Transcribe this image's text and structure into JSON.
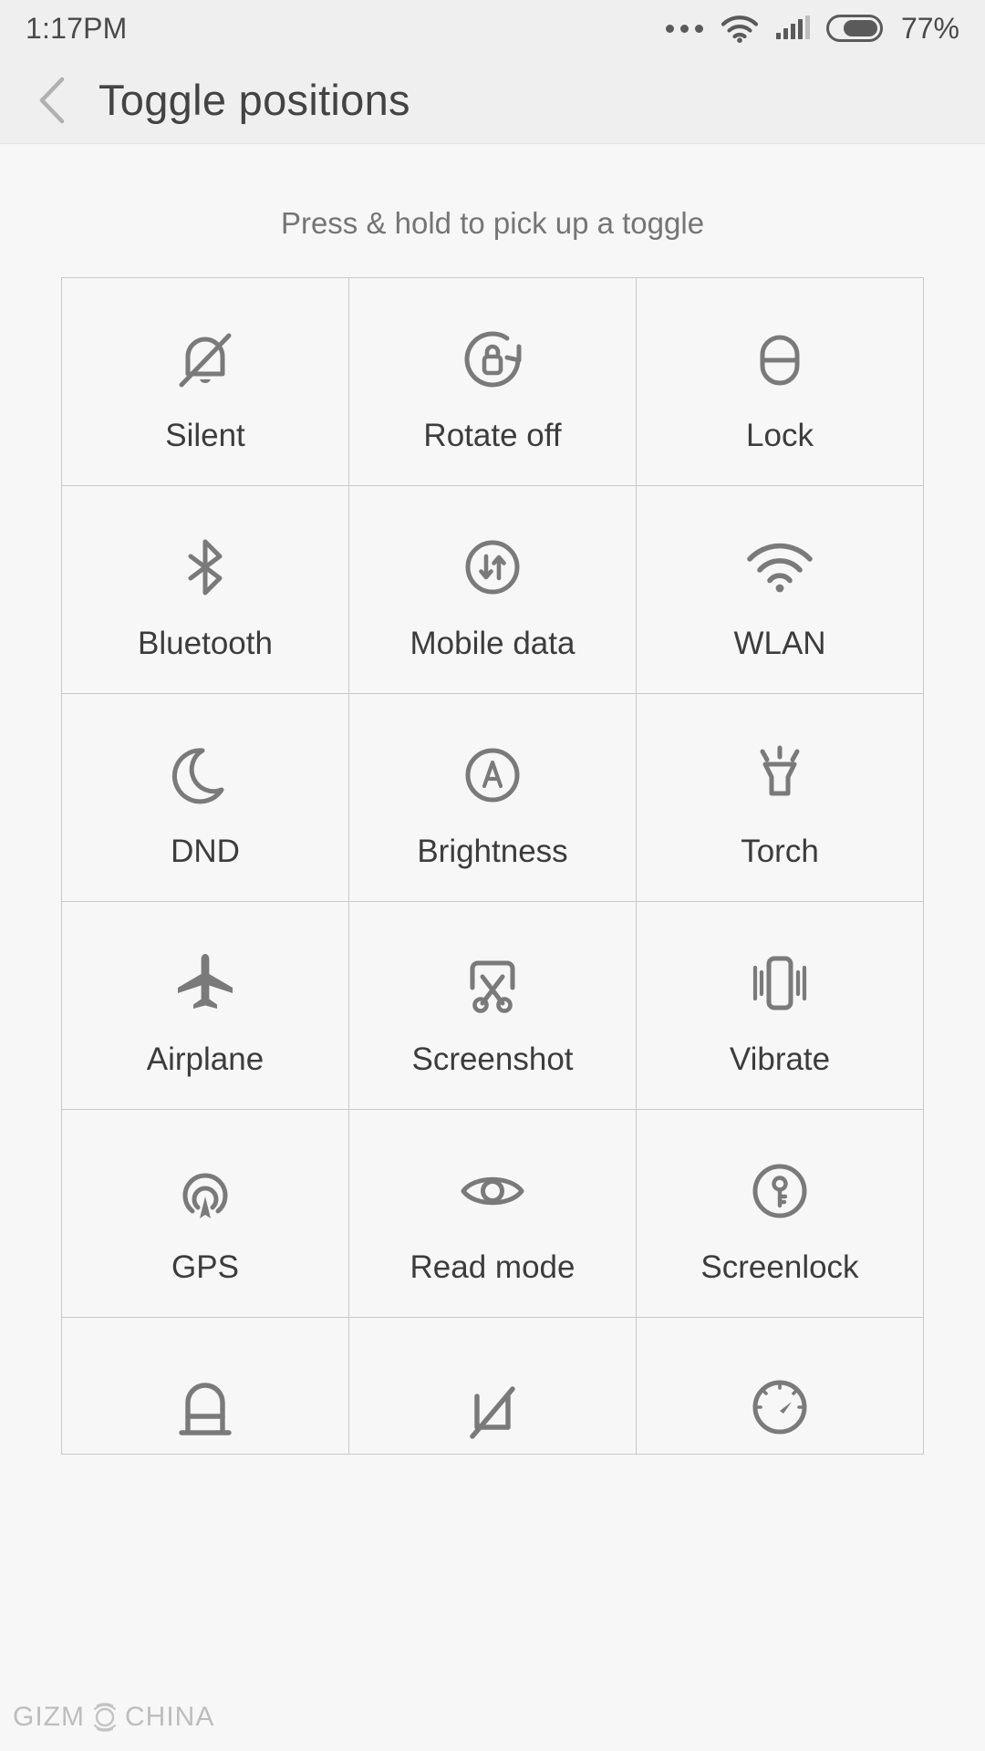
{
  "status_bar": {
    "time": "1:17PM",
    "battery_percent": "77%",
    "icons": {
      "more": "more-dots-icon",
      "wifi": "wifi-icon",
      "signal": "cellular-signal-icon",
      "battery": "battery-icon"
    },
    "signal_bars_filled": 4,
    "signal_bars_total": 5,
    "battery_level": 77
  },
  "app_bar": {
    "back_label": "back-chevron",
    "title": "Toggle positions"
  },
  "hint": {
    "text": "Press & hold to pick up a toggle"
  },
  "grid": {
    "columns": 3,
    "toggles": [
      {
        "label": "Silent",
        "icon": "bell-slash-icon"
      },
      {
        "label": "Rotate off",
        "icon": "rotate-lock-icon"
      },
      {
        "label": "Lock",
        "icon": "padlock-icon"
      },
      {
        "label": "Bluetooth",
        "icon": "bluetooth-icon"
      },
      {
        "label": "Mobile data",
        "icon": "mobile-data-icon"
      },
      {
        "label": "WLAN",
        "icon": "wifi-icon"
      },
      {
        "label": "DND",
        "icon": "moon-icon"
      },
      {
        "label": "Brightness",
        "icon": "brightness-auto-icon"
      },
      {
        "label": "Torch",
        "icon": "flashlight-icon"
      },
      {
        "label": "Airplane",
        "icon": "airplane-icon"
      },
      {
        "label": "Screenshot",
        "icon": "scissors-icon"
      },
      {
        "label": "Vibrate",
        "icon": "vibrate-icon"
      },
      {
        "label": "GPS",
        "icon": "gps-icon"
      },
      {
        "label": "Read mode",
        "icon": "eye-icon"
      },
      {
        "label": "Screenlock",
        "icon": "key-circle-icon"
      }
    ],
    "partial_row": [
      {
        "label": "",
        "icon": "lock-open-icon"
      },
      {
        "label": "",
        "icon": "data-off-icon"
      },
      {
        "label": "",
        "icon": "speedometer-icon"
      }
    ]
  },
  "watermark": {
    "text_left": "GIZM",
    "text_right": "CHINA",
    "logo": "gizmochina-logo-icon"
  },
  "colors": {
    "page_background": "#f7f7f7",
    "bar_background": "#efefef",
    "grid_line": "#c9c9c9",
    "icon_stroke": "#7a7a7a",
    "label_text": "#3c3c3c",
    "hint_text": "#757575",
    "title_text": "#434343"
  }
}
